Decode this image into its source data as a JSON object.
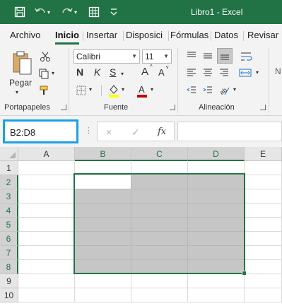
{
  "window": {
    "title": "Libro1 - Excel"
  },
  "quick_access": {
    "save_icon": "save-icon",
    "undo_icon": "undo-icon",
    "redo_icon": "redo-icon",
    "table_icon": "table-icon",
    "customize_icon": "chevron-down-icon"
  },
  "tabs": [
    {
      "label": "Archivo"
    },
    {
      "label": "Inicio"
    },
    {
      "label": "Insertar"
    },
    {
      "label": "Disposici"
    },
    {
      "label": "Fórmulas"
    },
    {
      "label": "Datos"
    },
    {
      "label": "Revisar"
    }
  ],
  "ribbon": {
    "clipboard": {
      "paste_label": "Pegar",
      "group_label": "Portapapeles"
    },
    "font": {
      "font_name": "Calibri",
      "font_size": "11",
      "bold": "N",
      "italic": "K",
      "underline": "S",
      "grow": "A",
      "shrink": "A",
      "group_label": "Fuente",
      "fill_color": "#ffff00",
      "font_color": "#c00000"
    },
    "alignment": {
      "group_label": "Alineación"
    }
  },
  "formula_bar": {
    "name_box": "B2:D8",
    "cancel_icon": "×",
    "enter_icon": "✓",
    "fx_label": "fx",
    "formula": ""
  },
  "sheet": {
    "columns": [
      "A",
      "B",
      "C",
      "D",
      "E"
    ],
    "rows": [
      "1",
      "2",
      "3",
      "4",
      "5",
      "6",
      "7",
      "8",
      "9",
      "10"
    ],
    "selection": "B2:D8",
    "active_cell": "B2",
    "accent": "#217346",
    "highlight": "#1ba1e2"
  }
}
